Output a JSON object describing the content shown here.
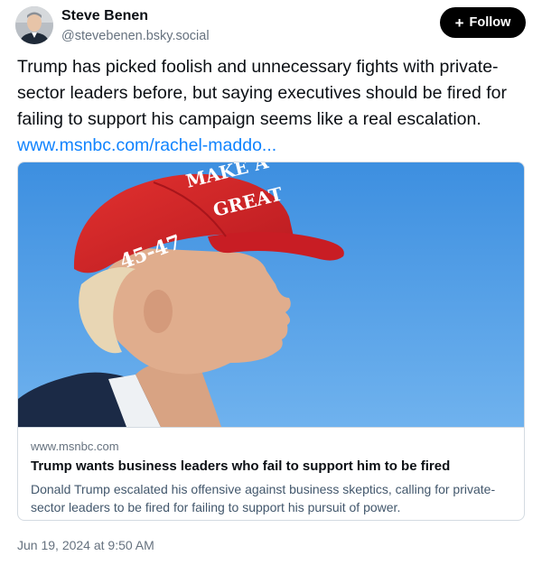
{
  "author": {
    "display_name": "Steve Benen",
    "handle": "@stevebenen.bsky.social",
    "avatar_icon": "user-avatar"
  },
  "follow": {
    "label": "Follow",
    "icon": "plus-icon"
  },
  "post": {
    "text": "Trump has picked foolish and unnecessary fights with private-sector leaders before, but saying executives should be fired for failing to support his campaign seems like a real escalation.",
    "link_text": "www.msnbc.com/rachel-maddo..."
  },
  "embed": {
    "image_cap_text_line1": "MAKE A",
    "image_cap_text_line2": "GREAT",
    "image_cap_side_text": "45-47",
    "domain": "www.msnbc.com",
    "title": "Trump wants business leaders who fail to support him to be fired",
    "description": "Donald Trump escalated his offensive against business skeptics, calling for private-sector leaders to be fired for failing to support his pursuit of power."
  },
  "timestamp": "Jun 19, 2024 at 9:50 AM",
  "colors": {
    "follow_bg": "#000000",
    "link": "#1083fe",
    "secondary_text": "#66727f",
    "border": "#d4dbe2",
    "sky": "#4f9fe4",
    "cap_red": "#d8232a"
  }
}
